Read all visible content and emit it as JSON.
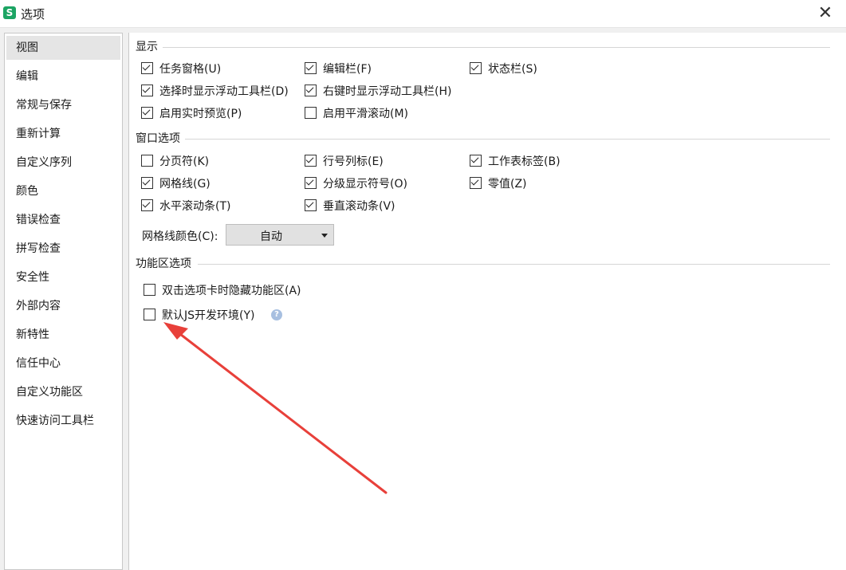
{
  "window": {
    "app_icon": "S",
    "title": "选项",
    "close_glyph": "✕"
  },
  "sidebar": {
    "items": [
      {
        "label": "视图",
        "selected": true
      },
      {
        "label": "编辑"
      },
      {
        "label": "常规与保存"
      },
      {
        "label": "重新计算"
      },
      {
        "label": "自定义序列"
      },
      {
        "label": "颜色"
      },
      {
        "label": "错误检查"
      },
      {
        "label": "拼写检查"
      },
      {
        "label": "安全性"
      },
      {
        "label": "外部内容"
      },
      {
        "label": "新特性"
      },
      {
        "label": "信任中心"
      },
      {
        "label": "自定义功能区"
      },
      {
        "label": "快速访问工具栏"
      }
    ]
  },
  "display": {
    "title": "显示",
    "options": [
      {
        "label": "任务窗格(U)",
        "checked": true
      },
      {
        "label": "编辑栏(F)",
        "checked": true
      },
      {
        "label": "状态栏(S)",
        "checked": true
      },
      {
        "label": "选择时显示浮动工具栏(D)",
        "checked": true
      },
      {
        "label": "右键时显示浮动工具栏(H)",
        "checked": true
      },
      {
        "label": "启用实时预览(P)",
        "checked": true
      },
      {
        "label": "启用平滑滚动(M)",
        "checked": false
      }
    ]
  },
  "window_options": {
    "title": "窗口选项",
    "options": [
      {
        "label": "分页符(K)",
        "checked": false
      },
      {
        "label": "行号列标(E)",
        "checked": true
      },
      {
        "label": "工作表标签(B)",
        "checked": true
      },
      {
        "label": "网格线(G)",
        "checked": true
      },
      {
        "label": "分级显示符号(O)",
        "checked": true
      },
      {
        "label": "零值(Z)",
        "checked": true
      },
      {
        "label": "水平滚动条(T)",
        "checked": true
      },
      {
        "label": "垂直滚动条(V)",
        "checked": true
      }
    ],
    "gridline_color_label": "网格线颜色(C):",
    "gridline_color_value": "自动"
  },
  "ribbon": {
    "title": "功能区选项",
    "options": [
      {
        "label": "双击选项卡时隐藏功能区(A)",
        "checked": false
      },
      {
        "label": "默认JS开发环境(Y)",
        "checked": false
      }
    ],
    "help_glyph": "?"
  },
  "colors": {
    "accent_green": "#1ca463",
    "annotation_arrow": "#e8403a"
  }
}
